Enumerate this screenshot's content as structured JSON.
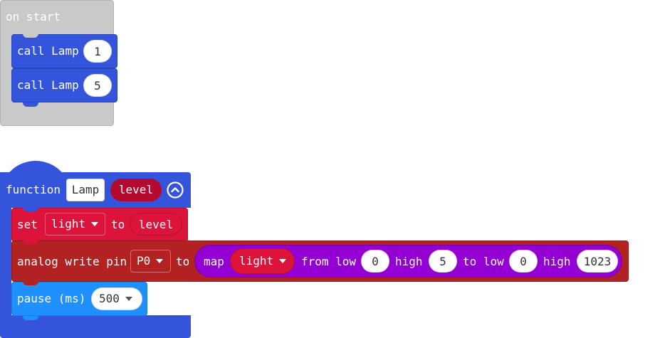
{
  "on_start": {
    "label": "on start",
    "calls": [
      {
        "keyword": "call",
        "name": "Lamp",
        "arg": "1"
      },
      {
        "keyword": "call",
        "name": "Lamp",
        "arg": "5"
      }
    ]
  },
  "function_block": {
    "keyword": "function",
    "name": "Lamp",
    "param": "level",
    "collapse_icon": "chevron-up-circle-icon"
  },
  "set_block": {
    "keyword": "set",
    "variable": "light",
    "to_label": "to",
    "value": "level"
  },
  "analog_write": {
    "label": "analog write pin",
    "pin": "P0",
    "to_label": "to",
    "map": {
      "keyword": "map",
      "variable": "light",
      "from_low_label": "from low",
      "from_low": "0",
      "high_label": "high",
      "from_high": "5",
      "to_low_label": "to low",
      "to_low": "0",
      "high_label_2": "high",
      "to_high": "1023"
    }
  },
  "pause_block": {
    "label": "pause (ms)",
    "value": "500"
  },
  "colors": {
    "workspace_bg": "#ffffff",
    "event_block": "#c9c9c9",
    "function_blue": "#3455db",
    "variable_red": "#dc143c",
    "pins_red": "#b22222",
    "math_purple": "#9400d3",
    "basic_blue": "#1e90ff"
  }
}
